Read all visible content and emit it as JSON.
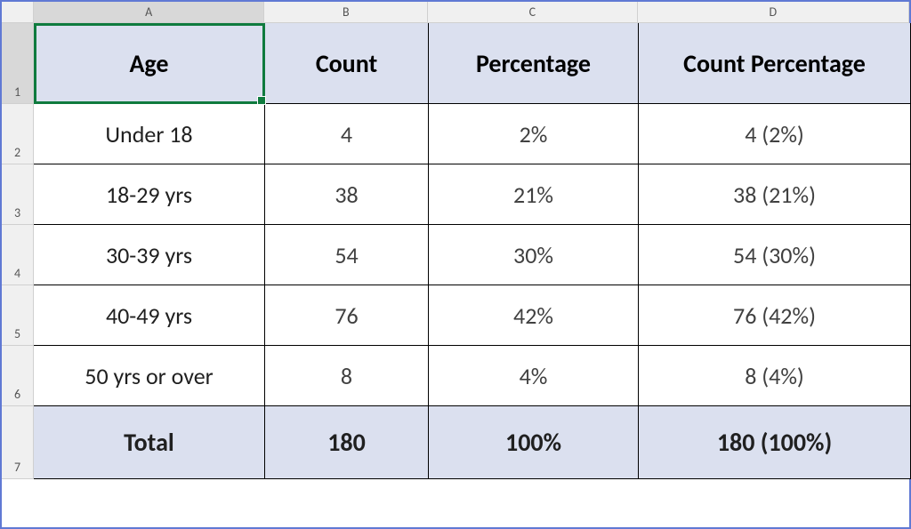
{
  "columns": {
    "A": "A",
    "B": "B",
    "C": "C",
    "D": "D"
  },
  "rows": {
    "r1": "1",
    "r2": "2",
    "r3": "3",
    "r4": "4",
    "r5": "5",
    "r6": "6",
    "r7": "7"
  },
  "table": {
    "headers": {
      "age": "Age",
      "count": "Count",
      "percentage": "Percentage",
      "count_percentage": "Count Percentage"
    },
    "rows": [
      {
        "age": "Under 18",
        "count": "4",
        "percentage": "2%",
        "count_percentage": "4 (2%)"
      },
      {
        "age": "18-29 yrs",
        "count": "38",
        "percentage": "21%",
        "count_percentage": "38 (21%)"
      },
      {
        "age": "30-39 yrs",
        "count": "54",
        "percentage": "30%",
        "count_percentage": "54 (30%)"
      },
      {
        "age": "40-49 yrs",
        "count": "76",
        "percentage": "42%",
        "count_percentage": "76 (42%)"
      },
      {
        "age": "50 yrs or over",
        "count": "8",
        "percentage": "4%",
        "count_percentage": "8 (4%)"
      }
    ],
    "total": {
      "label": "Total",
      "count": "180",
      "percentage": "100%",
      "count_percentage": "180 (100%)"
    }
  },
  "active_cell": "A1"
}
